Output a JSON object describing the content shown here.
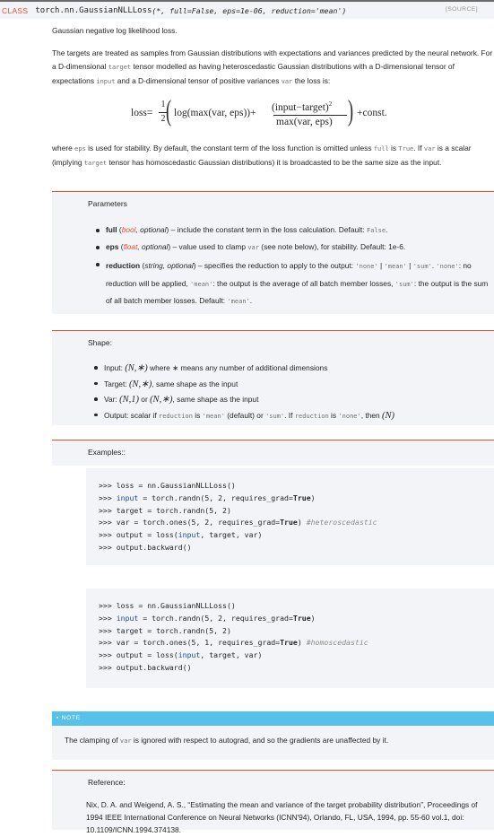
{
  "signature": {
    "kind": "CLASS",
    "name": "torch.nn.GaussianNLLLoss",
    "args": "(*, full=False, eps=1e-06, reduction='mean')",
    "source_link": "[SOURCE]"
  },
  "summary": "Gaussian negative log likelihood loss.",
  "intro": {
    "t1": "The targets are treated as samples from Gaussian distributions with expectations and variances predicted by the neural network. For a D-dimensional ",
    "c1": "target",
    "t2": " tensor modelled as having heteroscedastic Gaussian distributions with a D-dimensional tensor of expectations ",
    "c2": "input",
    "t3": " and a D-dimensional tensor of positive variances ",
    "c3": "var",
    "t4": " the loss is:"
  },
  "formula": {
    "lhs": "loss=",
    "half_num": "1",
    "half_den": "2",
    "log_part": "log(max(var, eps))+",
    "frac_num": "(input−target)",
    "exp": "2",
    "frac_den": "max(var, eps)",
    "rhs": "+const."
  },
  "stability": {
    "t1": "where ",
    "c1": "eps",
    "t2": " is used for stability. By default, the constant term of the loss function is omitted unless ",
    "c2": "full",
    "t3": " is ",
    "c3": "True",
    "t4": ". If ",
    "c4": "var",
    "t5": " is a scalar (implying ",
    "c5": "target",
    "t6": " tensor has homoscedastic Gaussian distributions) it is broadcasted to be the same size as the input."
  },
  "parameters": {
    "title": "Parameters",
    "items": [
      {
        "name": "full",
        "type": "bool",
        "opt": ", optional",
        "desc": ") – include the constant term in the loss calculation. Default: ",
        "default": "False",
        "end": "."
      },
      {
        "name": "eps",
        "type": "float",
        "opt": ", optional",
        "desc": ") – value used to clamp ",
        "code": "var",
        "desc2": " (see note below), for stability. Default: 1e-6."
      },
      {
        "name": "reduction",
        "type": "string, optional",
        "desc": ") – specifies the reduction to apply to the output: ",
        "o1": "'none'",
        "sep1": " | ",
        "o2": "'mean'",
        "sep2": " | ",
        "o3": "'sum'",
        "sep3": ". ",
        "o4": "'none'",
        "d2": ": no reduction will be applied, ",
        "o5": "'mean'",
        "d3": ": the output is the average of all batch member losses, ",
        "o6": "'sum'",
        "d4": ": the output is the sum of all batch member losses. Default: ",
        "o7": "'mean'",
        "end": "."
      }
    ]
  },
  "shape": {
    "title": "Shape:",
    "input": {
      "label": "Input: ",
      "math": "(N,∗)",
      "desc": " where ∗ means any number of additional dimensions"
    },
    "target": {
      "label": "Target: ",
      "math": "(N,∗)",
      "desc": ", same shape as the input"
    },
    "var": {
      "label": "Var: ",
      "m1": "(N,1)",
      "or": " or ",
      "m2": "(N,∗)",
      "desc": ", same shape as the input"
    },
    "output": {
      "label": "Output: scalar if ",
      "c1": "reduction",
      "t1": " is ",
      "c2": "'mean'",
      "t2": " (default) or ",
      "c3": "'sum'",
      "t3": ". If ",
      "c4": "reduction",
      "t4": " is ",
      "c5": "'none'",
      "t5": ", then ",
      "m": "(N)"
    }
  },
  "examples": {
    "title": "Examples::",
    "block1": [
      ">>> loss = nn.GaussianNLLLoss()",
      ">>> input = torch.randn(5, 2, requires_grad=True)",
      ">>> target = torch.randn(5, 2)",
      ">>> var = torch.ones(5, 2, requires_grad=True) #heteroscedastic",
      ">>> output = loss(input, target, var)",
      ">>> output.backward()"
    ],
    "block2": [
      ">>> loss = nn.GaussianNLLLoss()",
      ">>> input = torch.randn(5, 2, requires_grad=True)",
      ">>> target = torch.randn(5, 2)",
      ">>> var = torch.ones(5, 1, requires_grad=True) #homoscedastic",
      ">>> output = loss(input, target, var)",
      ">>> output.backward()"
    ]
  },
  "note": {
    "label": "• NOTE",
    "t1": "The clamping of ",
    "c1": "var",
    "t2": " is ignored with respect to autograd, and so the gradients are unaffected by it."
  },
  "reference": {
    "title": "Reference:",
    "text": "Nix, D. A. and Weigend, A. S., “Estimating the mean and variance of the target probability distribution”, Proceedings of 1994 IEEE International Conference on Neural Networks (ICNN'94), Orlando, FL, USA, 1994, pp. 55-60 vol.1, doi: 10.1109/ICNN.1994.374138."
  },
  "colors": {
    "accent": "#ee4c2c",
    "note_bar": "#56c2e9",
    "box_bg": "#f3f4f7"
  }
}
